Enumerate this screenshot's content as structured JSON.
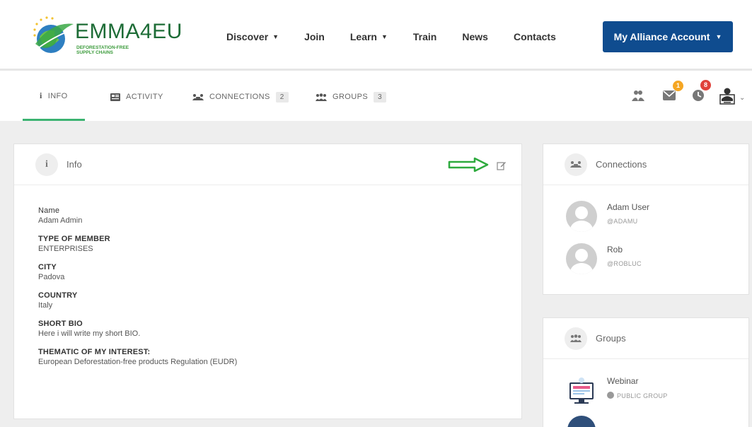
{
  "header": {
    "logo_text": "EMMA4EU",
    "logo_sub": "DEFORESTATION-FREE SUPPLY CHAINS",
    "nav": [
      {
        "label": "Discover",
        "caret": true
      },
      {
        "label": "Join",
        "caret": false
      },
      {
        "label": "Learn",
        "caret": true
      },
      {
        "label": "Train",
        "caret": false
      },
      {
        "label": "News",
        "caret": false
      },
      {
        "label": "Contacts",
        "caret": false
      }
    ],
    "account_label": "My Alliance Account"
  },
  "tabs": [
    {
      "label": "INFO",
      "icon": "info-icon",
      "count": ""
    },
    {
      "label": "ACTIVITY",
      "icon": "activity-icon",
      "count": ""
    },
    {
      "label": "CONNECTIONS",
      "icon": "connections-icon",
      "count": "2"
    },
    {
      "label": "GROUPS",
      "icon": "groups-icon",
      "count": "3"
    }
  ],
  "toolbar": {
    "messages_count": "1",
    "notifications_count": "8"
  },
  "info_card": {
    "title": "Info",
    "fields": [
      {
        "label": "Name",
        "value": "Adam Admin"
      },
      {
        "label": "TYPE OF MEMBER",
        "value": "ENTERPRISES"
      },
      {
        "label": "CITY",
        "value": "Padova"
      },
      {
        "label": "COUNTRY",
        "value": "Italy"
      },
      {
        "label": "SHORT BIO",
        "value": "Here i will write my short BIO."
      },
      {
        "label": "THEMATIC OF MY INTEREST:",
        "value": "European Deforestation-free products Regulation (EUDR)"
      }
    ]
  },
  "connections_card": {
    "title": "Connections",
    "people": [
      {
        "name": "Adam User",
        "handle": "@ADAMU"
      },
      {
        "name": "Rob",
        "handle": "@ROBLUC"
      }
    ]
  },
  "groups_card": {
    "title": "Groups",
    "groups": [
      {
        "name": "Webinar",
        "type": "PUBLIC GROUP"
      }
    ]
  },
  "colors": {
    "brand_green": "#1d6c36",
    "account_blue": "#0f4c8f",
    "active_tab": "#3cb371",
    "badge_orange": "#f5a623",
    "badge_red": "#e0413a"
  }
}
